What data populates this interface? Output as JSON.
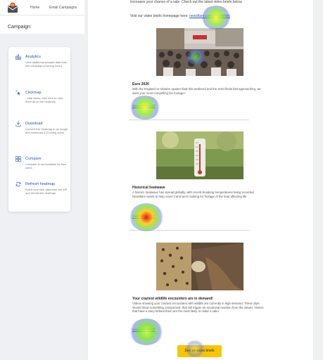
{
  "nav": {
    "home": "Home",
    "email_campaigns": "Email Campaigns"
  },
  "campaign_label": "Campaign:",
  "tools": [
    {
      "title": "Analytics",
      "desc": "View additional analytic data from this campaign (Coming soon)",
      "icon": "analytics-icon"
    },
    {
      "title": "Clickmap",
      "desc": "- total clicks, click here to view them all on the heatmap",
      "icon": "clickmap-icon"
    },
    {
      "title": "Download",
      "desc": "Convert this heatmap to an image and download it (Coming soon)",
      "icon": "download-icon"
    },
    {
      "title": "Compare",
      "desc": "Compare is not available for free users",
      "icon": "compare-icon"
    },
    {
      "title": "Refresh heatmap",
      "desc": "Fetch new click data from the API and rebuild the heatmap",
      "icon": "refresh-icon"
    }
  ],
  "email": {
    "intro_line": "increases your chance of a sale. Check out the latest video briefs below.",
    "visit_prefix": "Visit our video briefs homepage here: ",
    "visit_link": "newsflare.com/videobriefs",
    "stories": [
      {
        "title": "Euro 2020",
        "desc": "With the England vs Ukraine quarter-final this weekend and the semi-finals fast approaching, we want your most compelling fan footage!",
        "link": "View video brief"
      },
      {
        "title": "Historical heatwave",
        "desc": "A historic heatwave has spread globally, with record-breaking temperatures being recorded. Newsflare wants to help cover it and we're looking for footage of the heat affecting life",
        "link": "View video brief"
      },
      {
        "title": "Your craziest wildlife encounters are in demand!",
        "desc": "Videos showing your craziest encounters with wildlife are currently in high demand. These clips should show something unexpected, that will trigger an emotional reaction from the viewer. Videos that have a story behind them are the most likely to make a sale!",
        "link": "View video brief"
      }
    ],
    "cta": "See all video briefs"
  },
  "colors": {
    "link": "#2a56b5",
    "cta": "#f7c600",
    "panel_bg": "#eef0f4"
  }
}
